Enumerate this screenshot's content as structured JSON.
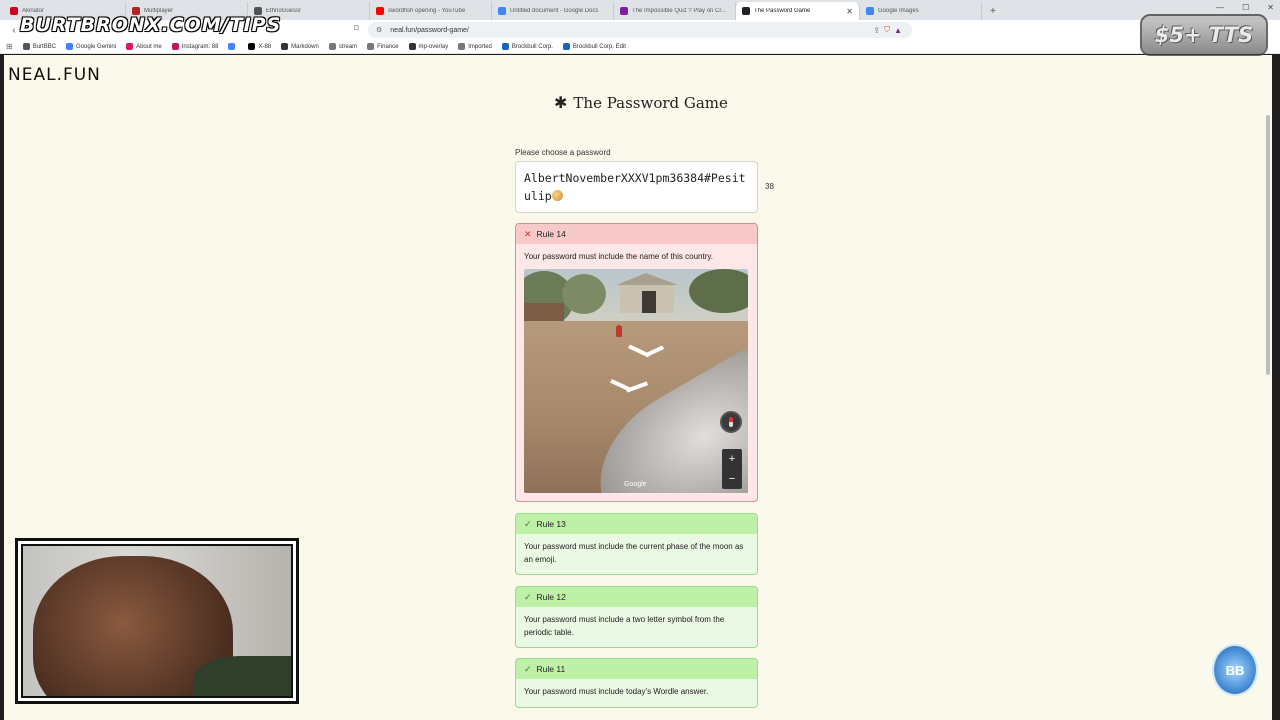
{
  "browser": {
    "tabs": [
      {
        "label": "Akinator",
        "color": "#d0021b",
        "active": false
      },
      {
        "label": "Multiplayer",
        "color": "#b3261e",
        "active": false
      },
      {
        "label": "EthnoGuessr",
        "color": "#555555",
        "active": false
      },
      {
        "label": "swordfish opening - YouTube",
        "color": "#ff0000",
        "active": false
      },
      {
        "label": "Untitled document - Google Docs",
        "color": "#4285f4",
        "active": false
      },
      {
        "label": "The Impossible Quiz ? Play on Cr...",
        "color": "#7b1fa2",
        "active": false
      },
      {
        "label": "The Password Game",
        "color": "#222222",
        "active": true
      },
      {
        "label": "Google Images",
        "color": "#4285f4",
        "active": false
      }
    ],
    "new_tab": "+",
    "url": "neal.fun/password-game/",
    "bookmarks": [
      {
        "label": "BurtBBC",
        "color": "#555555"
      },
      {
        "label": "Google Gemini",
        "color": "#4285f4"
      },
      {
        "label": "About me",
        "color": "#d81b60"
      },
      {
        "label": "Instagram: 88",
        "color": "#c2185b"
      },
      {
        "label": "",
        "color": "#4285f4"
      },
      {
        "label": "X-88",
        "color": "#000000"
      },
      {
        "label": "Markdown",
        "color": "#333333"
      },
      {
        "label": "stream",
        "color": "#777777"
      },
      {
        "label": "Finance",
        "color": "#777777"
      },
      {
        "label": "mp-overlay",
        "color": "#333333"
      },
      {
        "label": "Imported",
        "color": "#777777"
      },
      {
        "label": "Brockbull Corp.",
        "color": "#1565c0"
      },
      {
        "label": "Brockbull Corp. Edit",
        "color": "#1565c0"
      }
    ]
  },
  "page": {
    "logo": "NEAL.FUN",
    "title": "The Password Game",
    "password_label": "Please choose a password",
    "password_value": "AlbertNovemberXXXV1pm36384#Pesitulip",
    "password_length": "38",
    "rules": [
      {
        "title": "Rule 14",
        "status": "fail",
        "text": "Your password must include the name of this country.",
        "has_streetview": true
      },
      {
        "title": "Rule 13",
        "status": "pass",
        "text": "Your password must include the current phase of the moon as an emoji."
      },
      {
        "title": "Rule 12",
        "status": "pass",
        "text": "Your password must include a two letter symbol from the periodic table."
      },
      {
        "title": "Rule 11",
        "status": "pass",
        "text": "Your password must include today's Wordle answer."
      }
    ],
    "streetview": {
      "attribution": "Google",
      "zoom_in": "+",
      "zoom_out": "−"
    }
  },
  "overlay": {
    "watermark": "BURTBRONX.COM/TIPS",
    "tts_badge": "$5+ TTS",
    "corner_badge": "BB"
  }
}
